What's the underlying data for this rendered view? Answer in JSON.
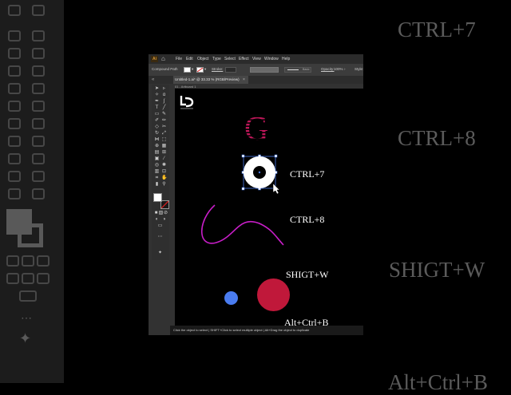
{
  "background_shortcuts": [
    "CTRL+7",
    "CTRL+8",
    "SHIGT+W",
    "Alt+Ctrl+B"
  ],
  "app": {
    "logo": "Ai",
    "menu": [
      "File",
      "Edit",
      "Object",
      "Type",
      "Select",
      "Effect",
      "View",
      "Window",
      "Help"
    ],
    "control_bar": {
      "selection": "Compound Path",
      "stroke_label": "Stroke:",
      "brush_label": "Basic",
      "opacity_label": "Opacity:",
      "opacity_value": "100%",
      "style_label": "Style:"
    },
    "document_tab": "Untitled-1.ai* @ 33.33 % (RGB/Preview)",
    "artboard_label": "01 - Artboard 1",
    "status_text": "Click the object to select  |  SHIFT+Click to select multiple object  |  Alt+Drag the object to duplicate"
  },
  "canvas": {
    "logo_text": "LD",
    "letter": "G",
    "shortcut_labels": [
      "CTRL+7",
      "CTRL+8",
      "SHIGT+W",
      "Alt+Ctrl+B"
    ]
  },
  "colors": {
    "accent_magenta": "#c0175a",
    "curve": "#c81ec8",
    "blue_dot": "#4a7cf0",
    "red_circle": "#c0183a"
  }
}
